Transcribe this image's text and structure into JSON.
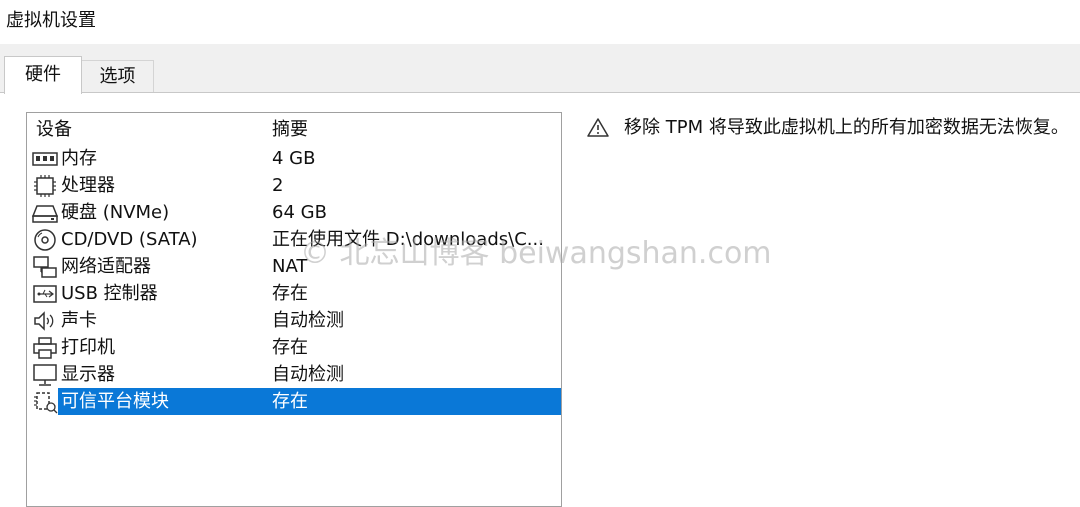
{
  "window": {
    "title": "虚拟机设置"
  },
  "tabs": [
    {
      "label": "硬件",
      "active": true
    },
    {
      "label": "选项",
      "active": false
    }
  ],
  "device_list": {
    "columns": [
      "设备",
      "摘要"
    ],
    "rows": [
      {
        "icon": "memory-icon",
        "name": "内存",
        "summary": "4 GB"
      },
      {
        "icon": "processor-icon",
        "name": "处理器",
        "summary": "2"
      },
      {
        "icon": "hard-disk-icon",
        "name": "硬盘 (NVMe)",
        "summary": "64 GB"
      },
      {
        "icon": "cd-dvd-icon",
        "name": "CD/DVD (SATA)",
        "summary": "正在使用文件 D:\\downloads\\C..."
      },
      {
        "icon": "network-adapter-icon",
        "name": "网络适配器",
        "summary": "NAT"
      },
      {
        "icon": "usb-icon",
        "name": "USB 控制器",
        "summary": "存在"
      },
      {
        "icon": "sound-card-icon",
        "name": "声卡",
        "summary": "自动检测"
      },
      {
        "icon": "printer-icon",
        "name": "打印机",
        "summary": "存在"
      },
      {
        "icon": "display-icon",
        "name": "显示器",
        "summary": "自动检测"
      },
      {
        "icon": "tpm-icon",
        "name": "可信平台模块",
        "summary": "存在",
        "selected": true
      }
    ]
  },
  "warning": {
    "icon": "warning-triangle-icon",
    "text": "移除 TPM 将导致此虚拟机上的所有加密数据无法恢复。"
  },
  "watermark": "© 北忘山博客 beiwangshan.com",
  "colors": {
    "selection": "#0a78d7",
    "tabstrip": "#f0f0f0"
  }
}
